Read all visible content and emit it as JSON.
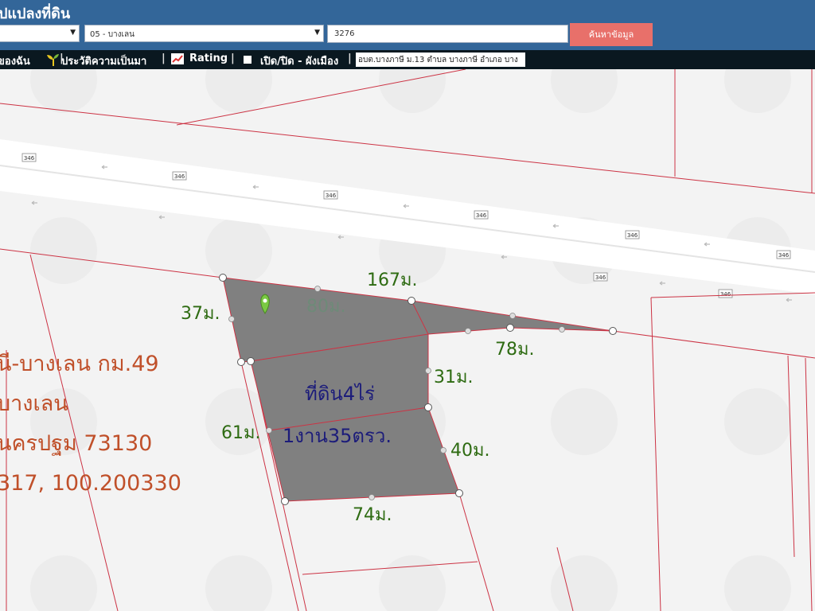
{
  "header": {
    "title": "ปแปลงที่ดิน",
    "province_select": "",
    "district_select": "05 - บางเลน",
    "parcel_input": "3276",
    "search_label": "ค้นหาข้อมูล"
  },
  "toolbar": {
    "my_item": "ของฉัน",
    "history": "ประวัติความเป็นมา",
    "rating": "Rating",
    "toggle": "เปิด/ปิด - ผังเมือง",
    "address": "อบต.บางภาษี ม.13 ตำบล บางภาษี อำเภอ บาง"
  },
  "map": {
    "road_label": "346",
    "area_line1": "ที่ดิน4ไร่",
    "area_line2": "1งาน35ตรว.",
    "dimensions": [
      "167ม.",
      "80ม.",
      "37ม.",
      "78ม.",
      "31ม.",
      "61ม.",
      "40ม.",
      "74ม."
    ],
    "info_lines": [
      "นี-บางเลน กม.49",
      "บางเลน",
      "นครปฐม 73130",
      "317, 100.200330"
    ]
  },
  "colors": {
    "header_bg": "#336699",
    "toolbar_bg": "#0a1820",
    "button_bg": "#e8706a",
    "parcel_fill": "#808080",
    "boundary_line": "#cc3344",
    "dimension_text": "#2e6b12",
    "info_text": "#c0502a",
    "area_text": "#1c1c7a"
  },
  "icons": [
    "chevron-down-icon",
    "plant-icon",
    "chart-icon",
    "square-icon",
    "map-pin-icon",
    "road-shield-icon",
    "arrow-left-icon",
    "watermark-seal-icon"
  ]
}
